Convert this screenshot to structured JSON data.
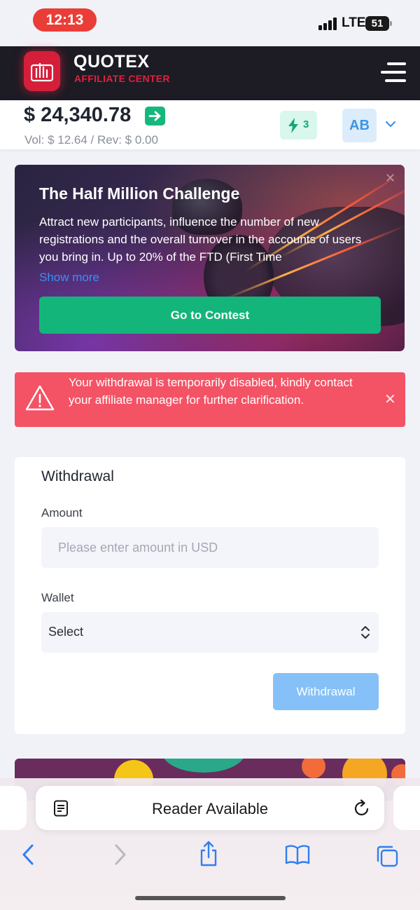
{
  "status_bar": {
    "time": "12:13",
    "network": "LTE",
    "battery": "51"
  },
  "header": {
    "brand": "QUOTEX",
    "subtitle": "AFFILIATE CENTER"
  },
  "balance": {
    "amount": "$ 24,340.78",
    "stats": "Vol: $ 12.64 / Rev: $ 0.00",
    "bolt_count": "3",
    "avatar_initials": "AB"
  },
  "promo": {
    "title": "The Half Million Challenge",
    "text": "Attract new participants, influence the number of new registrations and the overall turnover in the accounts of users you bring in. Up to 20% of the FTD (First Time",
    "show_more": "Show more",
    "button": "Go to Contest"
  },
  "alert": {
    "message": "Your withdrawal is temporarily disabled, kindly contact your affiliate manager for further clarification."
  },
  "withdrawal": {
    "title": "Withdrawal",
    "amount_label": "Amount",
    "amount_placeholder": "Please enter amount in USD",
    "wallet_label": "Wallet",
    "wallet_value": "Select",
    "button": "Withdrawal"
  },
  "safari": {
    "reader_text": "Reader Available"
  },
  "colors": {
    "brand_red": "#d51f3a",
    "green": "#13b57b",
    "alert_red": "#f35365",
    "button_blue": "#85c1f8",
    "ios_blue": "#2f7ff0"
  }
}
